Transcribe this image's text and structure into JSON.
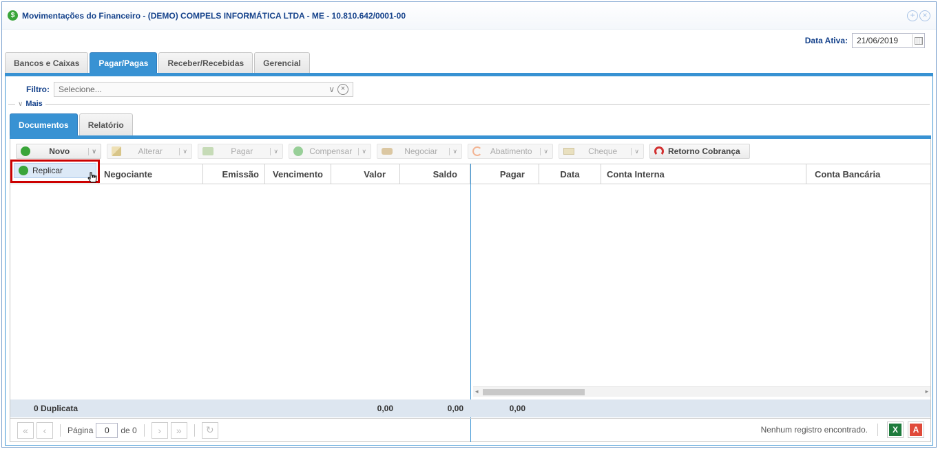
{
  "window": {
    "title": "Movimentações do Financeiro - (DEMO) COMPELS INFORMÁTICA LTDA - ME - 10.810.642/0001-00",
    "title_icon": "$"
  },
  "active_date": {
    "label": "Data Ativa:",
    "value": "21/06/2019"
  },
  "main_tabs": [
    {
      "label": "Bancos e Caixas",
      "active": false
    },
    {
      "label": "Pagar/Pagas",
      "active": true
    },
    {
      "label": "Receber/Recebidas",
      "active": false
    },
    {
      "label": "Gerencial",
      "active": false
    }
  ],
  "filter": {
    "label": "Filtro:",
    "placeholder": "Selecione..."
  },
  "mais_label": "Mais",
  "sub_tabs": [
    {
      "label": "Documentos",
      "active": true
    },
    {
      "label": "Relatório",
      "active": false
    }
  ],
  "toolbar": {
    "novo": "Novo",
    "alterar": "Alterar",
    "pagar": "Pagar",
    "compensar": "Compensar",
    "negociar": "Negociar",
    "abatimento": "Abatimento",
    "cheque": "Cheque",
    "retorno": "Retorno Cobrança"
  },
  "dropdown": {
    "replicar": "Replicar"
  },
  "columns_left": [
    "Negociante",
    "Emissão",
    "Vencimento",
    "Valor",
    "Saldo"
  ],
  "columns_right": [
    "Pagar",
    "Data",
    "Conta Interna",
    "Conta Bancária"
  ],
  "summary": {
    "count": "0 Duplicata",
    "valor": "0,00",
    "saldo": "0,00",
    "pagar": "0,00"
  },
  "pager": {
    "page_label": "Página",
    "page_value": "0",
    "of_label": "de 0",
    "status": "Nenhum registro encontrado.",
    "xls": "X",
    "pdf": "A"
  }
}
